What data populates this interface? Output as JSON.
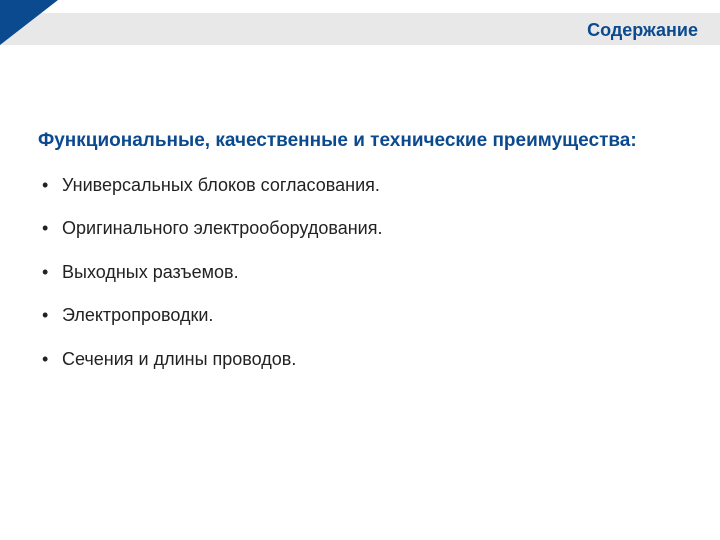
{
  "header": {
    "title": "Содержание"
  },
  "section": {
    "heading": "Функциональные, качественные и технические преимущества:"
  },
  "bullets": [
    "Универсальных блоков согласования.",
    "Оригинального электрооборудования.",
    "Выходных разъемов.",
    "Электропроводки.",
    "Сечения и длины проводов."
  ]
}
